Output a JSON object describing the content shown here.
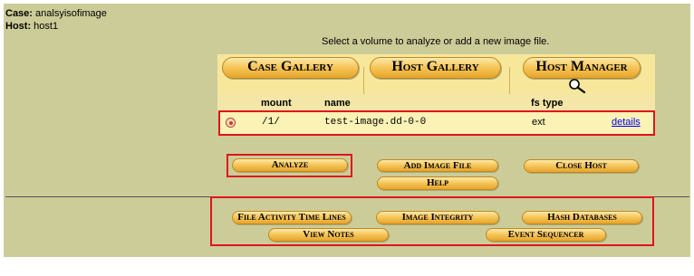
{
  "case_info": {
    "case_label": "Case:",
    "case_value": "analsyisofimage",
    "host_label": "Host:",
    "host_value": "host1"
  },
  "instruction": "Select a volume to analyze or add a new image file.",
  "tabs": {
    "case_gallery": "Case Gallery",
    "host_gallery": "Host Gallery",
    "host_manager": "Host Manager"
  },
  "table": {
    "headers": {
      "mount": "mount",
      "name": "name",
      "fs_type": "fs type"
    },
    "rows": [
      {
        "mount": "/1/",
        "name": "test-image.dd-0-0",
        "fs_type": "ext",
        "details": "details"
      }
    ]
  },
  "actions": {
    "analyze": "Analyze",
    "add_image_file": "Add Image File",
    "close_host": "Close Host",
    "help": "Help"
  },
  "tools": {
    "file_activity_time_lines": "File Activity Time Lines",
    "image_integrity": "Image Integrity",
    "hash_databases": "Hash Databases",
    "view_notes": "View Notes",
    "event_sequencer": "Event Sequencer"
  },
  "colors": {
    "panel": "#cccc99",
    "button_top": "#fde9a8",
    "button_bottom": "#e6a52a",
    "highlight_box": "#e0141e",
    "link": "#0000ee"
  },
  "icons": {
    "host_manager": "magnifier-icon",
    "volume_selector": "radio-button-icon"
  }
}
